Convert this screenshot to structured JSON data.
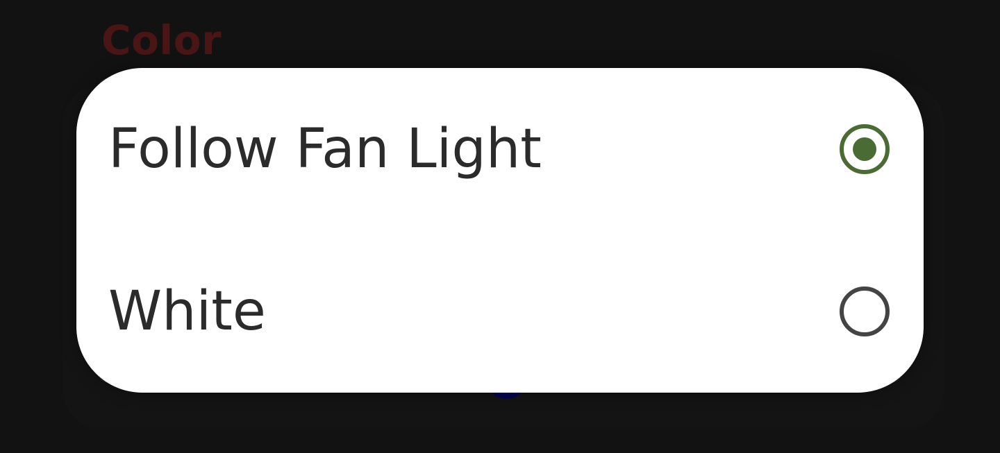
{
  "background": {
    "section_title": "Color"
  },
  "dialog": {
    "options": [
      {
        "label": "Follow Fan Light",
        "selected": true
      },
      {
        "label": "White",
        "selected": false
      }
    ]
  },
  "colors": {
    "accent": "#4a6b33",
    "radio_unselected": "#444444",
    "text": "#2b2b2b",
    "background": "#121212"
  }
}
